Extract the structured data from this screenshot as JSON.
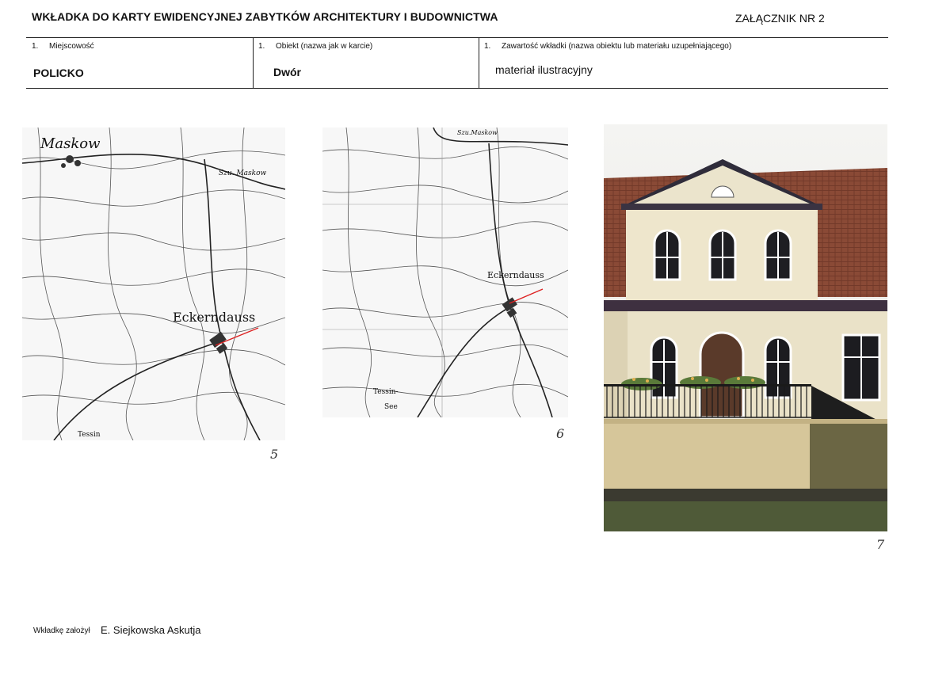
{
  "header": {
    "title": "WKŁADKA DO KARTY EWIDENCYJNEJ ZABYTKÓW ARCHITEKTURY I BUDOWNICTWA",
    "annex": "ZAŁĄCZNIK NR  2"
  },
  "fields": [
    {
      "num": "1.",
      "label": "Miejscowość",
      "value": "POLICKO"
    },
    {
      "num": "1.",
      "label": "Obiekt (nazwa jak w karcie)",
      "value": "Dwór"
    },
    {
      "num": "1.",
      "label": "Zawartość wkładki (nazwa obiektu lub materiału uzupełniającego)",
      "value": "materiał ilustracyjny"
    }
  ],
  "figures": {
    "map1": {
      "number": "5",
      "labels": {
        "town_top": "Maskow",
        "town_main": "Eckerndauss",
        "road": "Szu. Maskow",
        "town_bottom": "Tessin"
      }
    },
    "map2": {
      "number": "6",
      "labels": {
        "road": "Szu.Maskow",
        "town_main": "Eckerndauss",
        "lake": "Tessin-",
        "lake2": "See"
      }
    },
    "photo": {
      "number": "7"
    }
  },
  "footer": {
    "label": "Wkładkę założył",
    "author": "E. Siejkowska Askutja"
  }
}
